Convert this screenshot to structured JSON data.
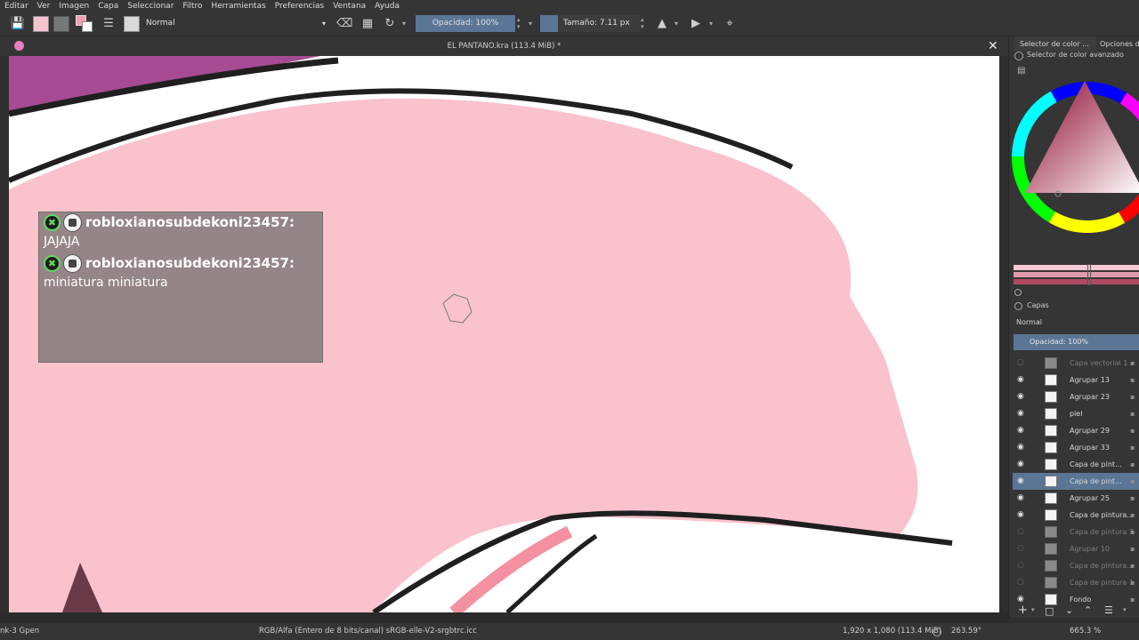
{
  "menubar": {
    "items": [
      "Editar",
      "Ver",
      "Imagen",
      "Capa",
      "Seleccionar",
      "Filtro",
      "Herramientas",
      "Preferencias",
      "Ventana",
      "Ayuda"
    ]
  },
  "toolbar": {
    "blend_mode": "Normal",
    "opacity": "Opacidad: 100%",
    "size": "Tamaño: 7.11 px",
    "accent_color": "#5a7595"
  },
  "document": {
    "title": "EL PANTANO.kra (113.4 MiB) *"
  },
  "chat": {
    "messages": [
      {
        "user": "robloxianosubdekoni23457:",
        "text": "JAJAJA"
      },
      {
        "user": "robloxianosubdekoni23457:",
        "text": "miniatura miniatura"
      }
    ]
  },
  "docker": {
    "tabs": [
      "Selector de color ...",
      "Opciones de"
    ],
    "color_selector_title": "Selector de color avanzado",
    "layers_title": "Capas",
    "layers_blend": "Normal",
    "layers_opacity": "Opacidad:  100%",
    "layers": [
      {
        "name": "Capa vectorial 1",
        "visible": false,
        "dim": true
      },
      {
        "name": "Agrupar 13",
        "visible": true,
        "dim": false
      },
      {
        "name": "Agrupar 23",
        "visible": true,
        "dim": false
      },
      {
        "name": "piel",
        "visible": true,
        "dim": false
      },
      {
        "name": "Agrupar 29",
        "visible": true,
        "dim": false
      },
      {
        "name": "Agrupar 33",
        "visible": true,
        "dim": false
      },
      {
        "name": "Capa de pint...",
        "visible": true,
        "dim": false
      },
      {
        "name": "Capa de pint...",
        "visible": true,
        "dim": false,
        "selected": true
      },
      {
        "name": "Agrupar 25",
        "visible": true,
        "dim": false
      },
      {
        "name": "Capa de pintura...",
        "visible": true,
        "dim": false
      },
      {
        "name": "Capa de pintura 7",
        "visible": false,
        "dim": true
      },
      {
        "name": "Agrupar 10",
        "visible": false,
        "dim": true
      },
      {
        "name": "Capa de pintura...",
        "visible": false,
        "dim": true
      },
      {
        "name": "Capa de pintura 1",
        "visible": false,
        "dim": true
      },
      {
        "name": "Fondo",
        "visible": true,
        "dim": false
      }
    ]
  },
  "statusbar": {
    "brush": "nk-3 Gpen",
    "color_space": "RGB/Alfa (Entero de 8 bits/canal)  sRGB-elle-V2-srgbtrc.icc",
    "dimensions": "1,920 x 1,080 (113.4 MiB)",
    "rotation": "263.59°",
    "zoom": "665.3 %"
  },
  "colors": {
    "pink": "#f9c2cc",
    "magenta": "#a64b93",
    "outline": "#1f1f1f"
  }
}
